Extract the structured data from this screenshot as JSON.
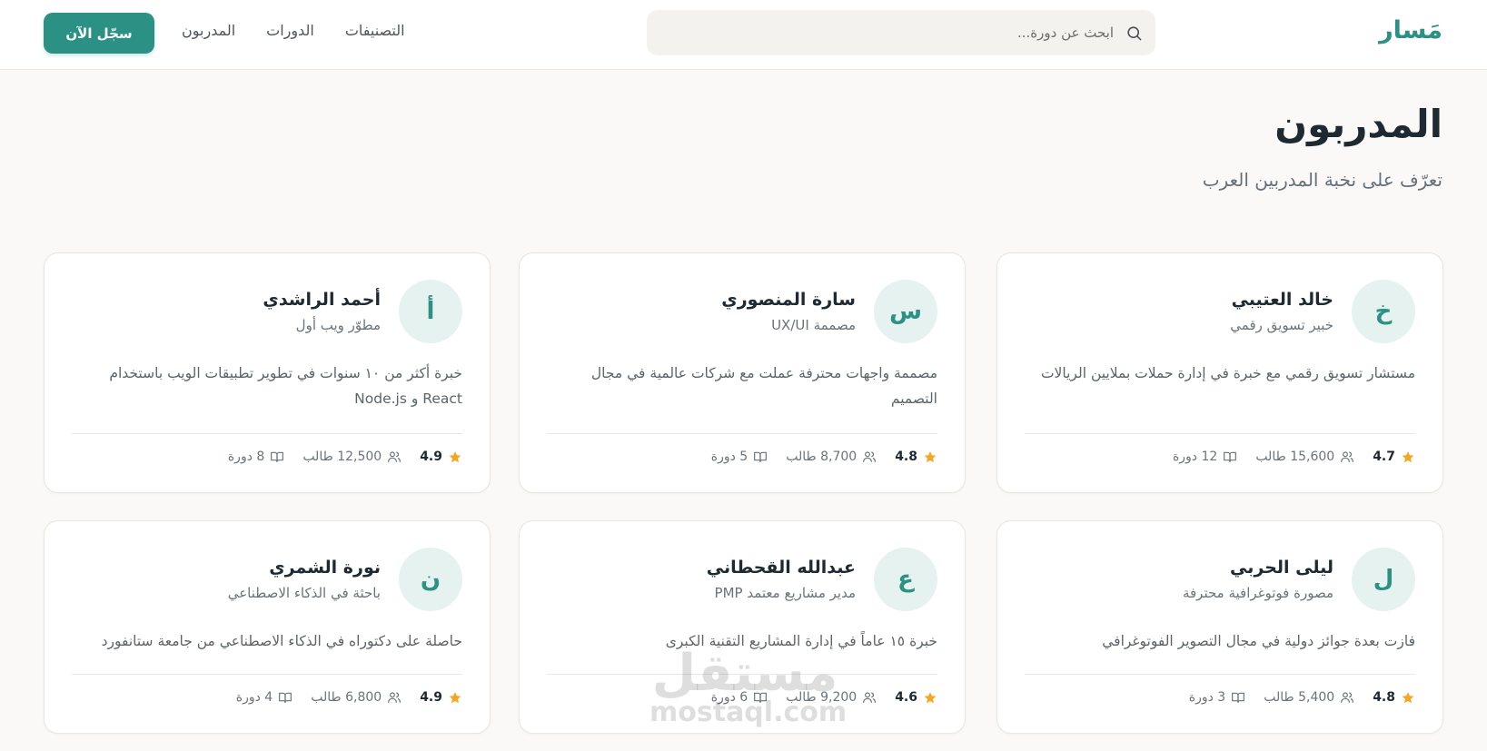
{
  "header": {
    "logo": "مَسار",
    "search_placeholder": "ابحث عن دورة...",
    "nav": [
      "التصنيفات",
      "الدورات",
      "المدربون"
    ],
    "cta_label": "سجّل الآن"
  },
  "page": {
    "title": "المدربون",
    "subtitle": "تعرّف على نخبة المدربين العرب"
  },
  "instructors": [
    {
      "initial": "أ",
      "name": "أحمد الراشدي",
      "role": "مطوّر ويب أول",
      "bio": "خبرة أكثر من ١٠ سنوات في تطوير تطبيقات الويب باستخدام React و Node.js",
      "rating": "4.9",
      "students": "12,500 طالب",
      "courses": "8 دورة"
    },
    {
      "initial": "س",
      "name": "سارة المنصوري",
      "role": "مصممة UX/UI",
      "bio": "مصممة واجهات محترفة عملت مع شركات عالمية في مجال التصميم",
      "rating": "4.8",
      "students": "8,700 طالب",
      "courses": "5 دورة"
    },
    {
      "initial": "خ",
      "name": "خالد العتيبي",
      "role": "خبير تسويق رقمي",
      "bio": "مستشار تسويق رقمي مع خبرة في إدارة حملات بملايين الريالات",
      "rating": "4.7",
      "students": "15,600 طالب",
      "courses": "12 دورة"
    },
    {
      "initial": "ن",
      "name": "نورة الشمري",
      "role": "باحثة في الذكاء الاصطناعي",
      "bio": "حاصلة على دكتوراه في الذكاء الاصطناعي من جامعة ستانفورد",
      "rating": "4.9",
      "students": "6,800 طالب",
      "courses": "4 دورة"
    },
    {
      "initial": "ع",
      "name": "عبدالله القحطاني",
      "role": "مدير مشاريع معتمد PMP",
      "bio": "خبرة ١٥ عاماً في إدارة المشاريع التقنية الكبرى",
      "rating": "4.6",
      "students": "9,200 طالب",
      "courses": "6 دورة"
    },
    {
      "initial": "ل",
      "name": "ليلى الحربي",
      "role": "مصورة فوتوغرافية محترفة",
      "bio": "فازت بعدة جوائز دولية في مجال التصوير الفوتوغرافي",
      "rating": "4.8",
      "students": "5,400 طالب",
      "courses": "3 دورة"
    }
  ],
  "watermark": {
    "ar": "مستقل",
    "en": "mostaql.com"
  },
  "colors": {
    "accent": "#2a9184",
    "star": "#f5a623",
    "background": "#faf9f7"
  },
  "icons": {
    "search": "search-icon",
    "star": "star-icon",
    "students": "users-icon",
    "courses": "book-icon"
  }
}
